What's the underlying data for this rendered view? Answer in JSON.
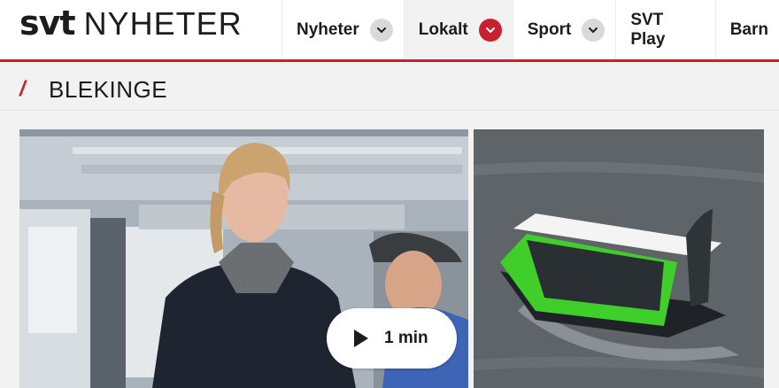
{
  "logo": {
    "brand": "svt",
    "section": "NYHETER"
  },
  "nav": {
    "items": [
      {
        "label": "Nyheter",
        "has_dropdown": true,
        "active": false
      },
      {
        "label": "Lokalt",
        "has_dropdown": true,
        "active": true
      },
      {
        "label": "Sport",
        "has_dropdown": true,
        "active": false
      },
      {
        "label": "SVT Play",
        "has_dropdown": false,
        "active": false
      },
      {
        "label": "Barn",
        "has_dropdown": false,
        "active": false
      }
    ]
  },
  "region": {
    "name": "BLEKINGE"
  },
  "video": {
    "duration_label": "1 min",
    "icon": "play-icon"
  },
  "colors": {
    "accent": "#c8202f",
    "chevron_bg": "#d9d9d9",
    "header_bg": "#ffffff",
    "page_bg": "#f2f2f2"
  }
}
